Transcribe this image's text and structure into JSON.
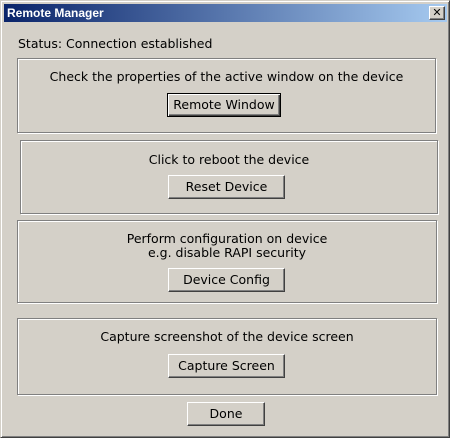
{
  "window": {
    "title": "Remote Manager",
    "close_glyph": "✕"
  },
  "status": {
    "label": "Status:",
    "value": "Connection established"
  },
  "groups": [
    {
      "description": "Check the properties of the active window on the device",
      "button_label": "Remote Window"
    },
    {
      "description": "Click to reboot the device",
      "button_label": "Reset Device"
    },
    {
      "description_line1": "Perform configuration on device",
      "description_line2": "e.g. disable RAPI security",
      "button_label": "Device Config"
    },
    {
      "description": "Capture screenshot of the device screen",
      "button_label": "Capture Screen"
    }
  ],
  "footer": {
    "done_label": "Done"
  },
  "colors": {
    "face": "#d4d0c8",
    "title_start": "#0a246a",
    "title_end": "#a6caf0"
  }
}
